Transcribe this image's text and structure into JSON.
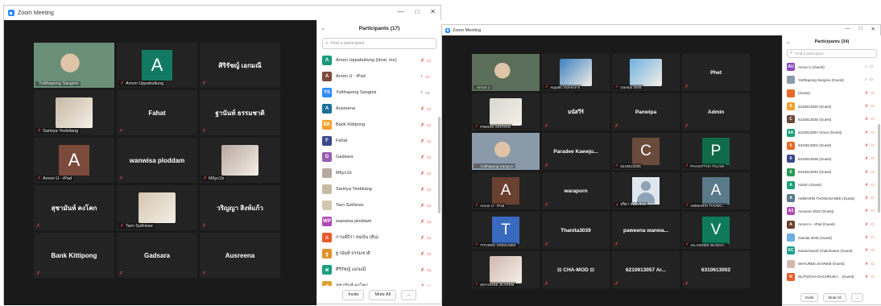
{
  "left_window": {
    "title": "Zoom Meeting",
    "controls": [
      "—",
      "□",
      "✕"
    ],
    "participants_title": "Participants (17)",
    "search_placeholder": "Find a participant",
    "tiles": [
      {
        "name": "Yutthapong Sangnoi",
        "kind": "video",
        "active": true,
        "color": "#6a8f77"
      },
      {
        "name": "Arnon Uppabullung",
        "kind": "letter",
        "letter": "A",
        "color": "#127a62"
      },
      {
        "name": "ศิริรัชญ์ เอกมณี",
        "kind": "text"
      },
      {
        "name": "Sarinya Yeebilang",
        "kind": "thumb",
        "color": "#c7b9a4"
      },
      {
        "name": "Fahat",
        "kind": "text"
      },
      {
        "name": "ฐานันท์ ธรรมชาติ",
        "kind": "text"
      },
      {
        "name": "Arnon U - iPad",
        "kind": "letter",
        "letter": "A",
        "color": "#7b4a3a"
      },
      {
        "name": "wanwisa ploddam",
        "kind": "text"
      },
      {
        "name": "M6yc1b",
        "kind": "thumb",
        "color": "#b8a8a1"
      },
      {
        "name": "สุชามันห์ คงโคก",
        "kind": "text"
      },
      {
        "name": "Tarn Suthinee",
        "kind": "thumb",
        "color": "#d4c6b0"
      },
      {
        "name": "วริญญา สิงห์แก้ว",
        "kind": "text"
      },
      {
        "name": "Bank Kittipong",
        "kind": "text"
      },
      {
        "name": "Gadsara",
        "kind": "text"
      },
      {
        "name": "Ausreena",
        "kind": "text"
      }
    ],
    "participants": [
      {
        "name": "Arnon Uppabullung (Host, me)",
        "abbr": "A",
        "color": "#1a9a7c",
        "mic": "mute",
        "cam": "off"
      },
      {
        "name": "Arnon U - iPad",
        "abbr": "A",
        "color": "#7b4a3a",
        "mic": "on",
        "cam": "off"
      },
      {
        "name": "Yutthapong Sangnoi",
        "abbr": "YS",
        "color": "#2d8cff",
        "mic": "on",
        "cam": "on"
      },
      {
        "name": "Ausreena",
        "abbr": "A",
        "color": "#1a6e9a",
        "mic": "mute",
        "cam": "off"
      },
      {
        "name": "Bank Kittipong",
        "abbr": "BK",
        "color": "#f0a030",
        "mic": "mute",
        "cam": "off"
      },
      {
        "name": "Fahat",
        "abbr": "F",
        "color": "#3a4a8a",
        "mic": "mute",
        "cam": "off"
      },
      {
        "name": "Gadsara",
        "abbr": "G",
        "color": "#9a5ab0",
        "mic": "mute",
        "cam": "off"
      },
      {
        "name": "M6yc1b",
        "abbr": "",
        "color": "#b8a8a1",
        "mic": "mute",
        "cam": "off"
      },
      {
        "name": "Sarinya Yeebilang",
        "abbr": "",
        "color": "#c7b9a4",
        "mic": "mute",
        "cam": "off"
      },
      {
        "name": "Tarn Suthinee",
        "abbr": "",
        "color": "#d4c6b0",
        "mic": "mute",
        "cam": "off"
      },
      {
        "name": "wanwisa ploddam",
        "abbr": "WP",
        "color": "#b04ab8",
        "mic": "mute",
        "cam": "off"
      },
      {
        "name": "กานต์ธิรา คมนัน (ต้น)",
        "abbr": "ก",
        "color": "#e85a2a",
        "mic": "mute",
        "cam": "off"
      },
      {
        "name": "ฐานันท์ ธรรมชาติ",
        "abbr": "ฐ",
        "color": "#e0902a",
        "mic": "mute",
        "cam": "off"
      },
      {
        "name": "ศิริรัชญ์ เอกมณี",
        "abbr": "ศ",
        "color": "#1aa080",
        "mic": "mute",
        "cam": "off"
      },
      {
        "name": "สุชามันห์ คงโคก",
        "abbr": "ส",
        "color": "#e0a030",
        "mic": "mute",
        "cam": "off"
      }
    ],
    "invite_label": "Invite",
    "mute_all_label": "Mute All",
    "more_label": "..."
  },
  "right_window": {
    "title": "Zoom Meeting",
    "controls": [
      "—",
      "□",
      "✕"
    ],
    "participants_title": "Participants (34)",
    "search_placeholder": "Find a participant",
    "tiles": [
      {
        "name": "Arnon U",
        "kind": "video",
        "active": true,
        "color": "#5b6e5a"
      },
      {
        "name": "Aquatic Science 8",
        "kind": "thumb",
        "color": "#3a7fc0"
      },
      {
        "name": "Gamtai 3045",
        "kind": "thumb",
        "color": "#6fb0e0"
      },
      {
        "name": "Phet",
        "kind": "text"
      },
      {
        "name": "PIMSIRI ARPORN",
        "kind": "thumb",
        "color": "#d8d8d0"
      },
      {
        "name": "มนัสวีร์",
        "kind": "text"
      },
      {
        "name": "Panwipa",
        "kind": "text"
      },
      {
        "name": "Admin",
        "kind": "text"
      },
      {
        "name": "Yutthapong Sangnoi",
        "kind": "video",
        "active": false,
        "color": "#8a9aa8"
      },
      {
        "name": "Paradee  Kaewju...",
        "kind": "text"
      },
      {
        "name": "6210613035",
        "kind": "letter",
        "letter": "C",
        "color": "#6a4a3a"
      },
      {
        "name": "PHASITTHA TALAM",
        "kind": "letter",
        "letter": "P",
        "color": "#0f6b4a"
      },
      {
        "name": "Arnon U - iPad",
        "kind": "letter",
        "letter": "A",
        "color": "#6a4030"
      },
      {
        "name": "waraporn",
        "kind": "text"
      },
      {
        "name": "ฟริยา จันทะรักษ์",
        "kind": "person"
      },
      {
        "name": "AMMARIN THONG...",
        "kind": "letter",
        "letter": "A",
        "color": "#5a7a8a"
      },
      {
        "name": "TITAREE SRIMANEE",
        "kind": "letter",
        "letter": "T",
        "color": "#3a6ac0"
      },
      {
        "name": "Thanita3039",
        "kind": "text"
      },
      {
        "name": "paweena  wanwa...",
        "kind": "text"
      },
      {
        "name": "VILASINEE BUNCH...",
        "kind": "letter",
        "letter": "V",
        "color": "#0f7a5a"
      },
      {
        "name": "MAYUREE JKAREM",
        "kind": "thumb",
        "color": "#d0b8b0"
      },
      {
        "name": "⊡ CHA-MOD ⊡",
        "kind": "text"
      },
      {
        "name": "6210613057 Ar...",
        "kind": "text"
      },
      {
        "name": "6310613002",
        "kind": "text"
      }
    ],
    "participants": [
      {
        "name": "Arnon U (Guest)",
        "abbr": "AU",
        "color": "#8a4ac0",
        "mic": "on",
        "cam": "off"
      },
      {
        "name": "Yutthapong Sangnoi (Guest)",
        "abbr": "",
        "color": "#8a9aa8",
        "mic": "on",
        "cam": "on"
      },
      {
        "name": "(Guest)",
        "abbr": "",
        "color": "#e86a2a",
        "mic": "mute",
        "cam": "off"
      },
      {
        "name": "6210613020 (Guest)",
        "abbr": "6",
        "color": "#f0a030",
        "mic": "mute",
        "cam": "off"
      },
      {
        "name": "6210613035 (Guest)",
        "abbr": "C",
        "color": "#6a4a3a",
        "mic": "mute",
        "cam": "off"
      },
      {
        "name": "6210613057 Arnon (Guest)",
        "abbr": "6A",
        "color": "#1aa07a",
        "mic": "mute",
        "cam": "off"
      },
      {
        "name": "6310613002 (Guest)",
        "abbr": "6",
        "color": "#e86a2a",
        "mic": "mute",
        "cam": "off"
      },
      {
        "name": "6310613035 (Guest)",
        "abbr": "6",
        "color": "#3a4a8a",
        "mic": "mute",
        "cam": "off"
      },
      {
        "name": "6310613040 (Guest)",
        "abbr": "6",
        "color": "#2a9a5a",
        "mic": "mute",
        "cam": "off"
      },
      {
        "name": "Admin (Guest)",
        "abbr": "A",
        "color": "#1aa07a",
        "mic": "mute",
        "cam": "off"
      },
      {
        "name": "AMMARIN THONGSANEE (Guest)",
        "abbr": "A",
        "color": "#5a7a8a",
        "mic": "mute",
        "cam": "off"
      },
      {
        "name": "Anusara 3032 (Guest)",
        "abbr": "A3",
        "color": "#b04ab8",
        "mic": "mute",
        "cam": "off"
      },
      {
        "name": "Arnon U - iPad (Guest)",
        "abbr": "A",
        "color": "#6a4030",
        "mic": "mute",
        "cam": "off"
      },
      {
        "name": "Gamtai 3045 (Guest)",
        "abbr": "",
        "color": "#6fb0e0",
        "mic": "mute",
        "cam": "off"
      },
      {
        "name": "Kwanchanok Chatchanee (Guest)",
        "abbr": "KC",
        "color": "#1aa08a",
        "mic": "mute",
        "cam": "off"
      },
      {
        "name": "MAYUREE JKAREM (Guest)",
        "abbr": "",
        "color": "#d0b8b0",
        "mic": "mute",
        "cam": "off"
      },
      {
        "name": "NUTNICHA RACHRUEA...  (Guest)",
        "abbr": "N",
        "color": "#e85a2a",
        "mic": "mute",
        "cam": "off"
      }
    ],
    "invite_label": "Invite",
    "mute_all_label": "Mute All",
    "more_label": "..."
  }
}
